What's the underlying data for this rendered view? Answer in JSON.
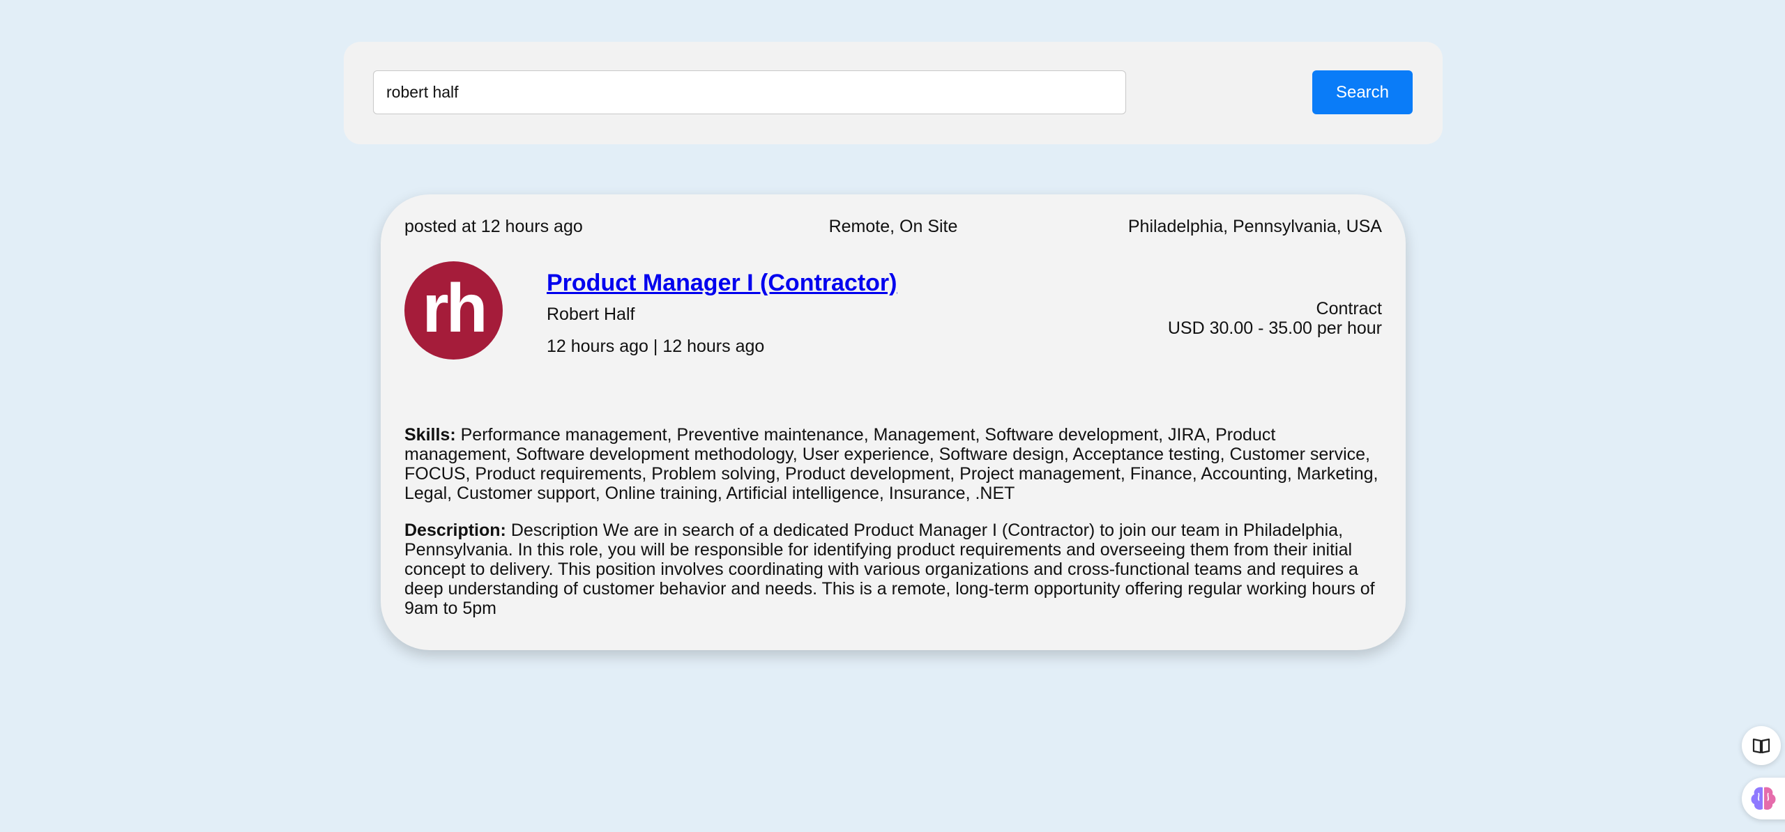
{
  "search": {
    "query": "robert half",
    "button_label": "Search"
  },
  "job": {
    "posted": "posted at 12 hours ago",
    "work_mode": "Remote, On Site",
    "location": "Philadelphia, Pennsylvania, USA",
    "logo_text": "rh",
    "title": "Product Manager I (Contractor)",
    "company": "Robert Half",
    "dates": "12 hours ago | 12 hours ago",
    "employment_type": "Contract",
    "salary": "USD 30.00 - 35.00 per hour",
    "skills_label": "Skills:",
    "skills": "Performance management, Preventive maintenance, Management, Software development, JIRA, Product management, Software development methodology, User experience, Software design, Acceptance testing, Customer service, FOCUS, Product requirements, Problem solving, Product development, Project management, Finance, Accounting, Marketing, Legal, Customer support, Online training, Artificial intelligence, Insurance, .NET",
    "description_label": "Description:",
    "description": "Description We are in search of a dedicated Product Manager I (Contractor) to join our team in Philadelphia, Pennsylvania. In this role, you will be responsible for identifying product requirements and overseeing them from their initial concept to delivery. This position involves coordinating with various organizations and cross-functional teams and requires a deep understanding of customer behavior and needs. This is a remote, long-term opportunity offering regular working hours of 9am to 5pm"
  },
  "side_buttons": {
    "book_icon": "book-icon",
    "brain_icon": "brain-icon"
  },
  "colors": {
    "background": "#e2eef7",
    "accent": "#0a7cf8",
    "logo": "#a51c3a",
    "link": "#0000ee"
  }
}
